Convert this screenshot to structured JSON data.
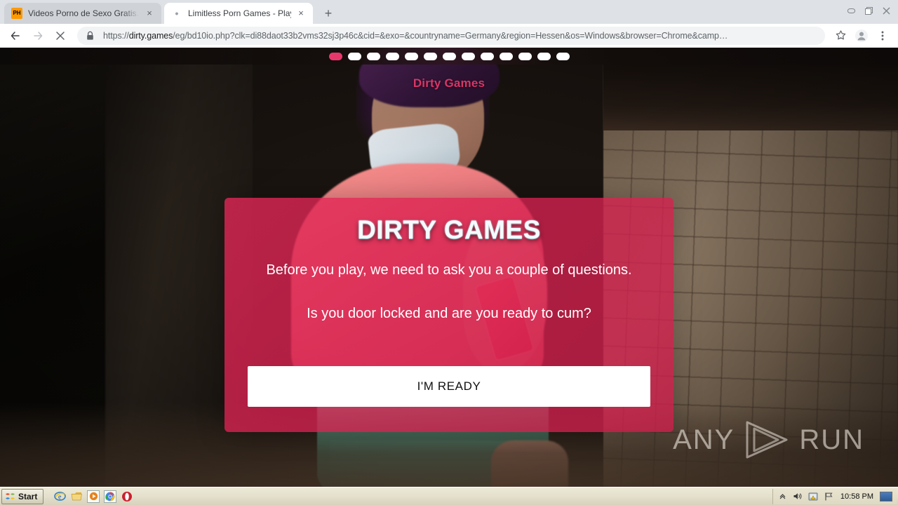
{
  "browser": {
    "tabs": [
      {
        "title": "Videos Porno de Sexo Gratis. Pelicula",
        "favicon": "ph-logo-icon",
        "favicon_label": "PH",
        "active": false,
        "close_label": "×"
      },
      {
        "title": "Limitless Porn Games - Play Now",
        "favicon": "loading-spinner-icon",
        "favicon_label": "•",
        "active": true,
        "close_label": "×"
      }
    ],
    "new_tab_label": "+",
    "window_controls": {
      "minimize": "minimize-icon",
      "maximize": "restore-icon",
      "close": "close-icon"
    },
    "nav": {
      "back": "back-arrow-icon",
      "forward": "forward-arrow-icon",
      "stop": "stop-x-icon",
      "lock": "lock-icon"
    },
    "omnibox": {
      "scheme": "https://",
      "host": "dirty.games",
      "path_query": "/eg/bd10io.php?clk=di88daot33b2vms32sj3p46c&cid=&exo=&countryname=Germany&region=Hessen&os=Windows&browser=Chrome&camp…",
      "full_url": "https://dirty.games/eg/bd10io.php?clk=di88daot33b2vms32sj3p46c&cid=&exo=&countryname=Germany&region=Hessen&os=Windows&browser=Chrome&camp…"
    },
    "toolbar_right": {
      "bookmark": "star-icon",
      "profile": "account-avatar-icon",
      "menu": "three-dot-menu-icon"
    }
  },
  "page": {
    "site_logo": "Dirty Games",
    "progress": {
      "total_dots": 13,
      "active_index": 0
    },
    "card": {
      "title": "DIRTY GAMES",
      "line1": "Before you play, we need to ask you a couple of questions.",
      "line2": "Is you door locked and are you ready to cum?",
      "cta_label": "I'M READY",
      "accent_color": "#e22655",
      "cta_bg": "#ffffff",
      "cta_text_color": "#111111"
    },
    "watermark": {
      "left": "ANY",
      "right": "RUN",
      "icon": "play-triangle-icon"
    }
  },
  "taskbar": {
    "start_label": "Start",
    "quick_launch": [
      {
        "name": "internet-explorer-icon",
        "glyph": "e"
      },
      {
        "name": "show-desktop-icon",
        "glyph": "▤"
      },
      {
        "name": "windows-media-player-icon",
        "glyph": "▶"
      },
      {
        "name": "google-chrome-icon",
        "glyph": "◉"
      },
      {
        "name": "opera-browser-icon",
        "glyph": "O"
      }
    ],
    "tray": {
      "expand": "chevron-up-icon",
      "volume": "speaker-icon",
      "security": "security-shield-icon",
      "network": "network-flag-icon",
      "clock": "10:58 PM",
      "desktop": "show-desktop-tray-icon"
    }
  }
}
